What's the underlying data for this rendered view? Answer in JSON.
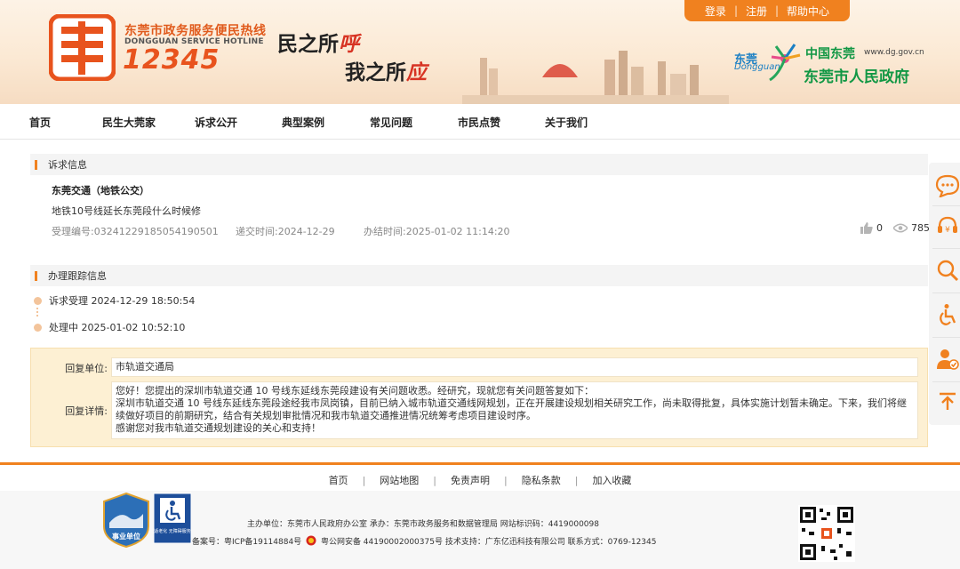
{
  "header": {
    "hotline_cn": "东莞市政务服务便民热线",
    "hotline_en": "DONGGUAN SERVICE HOTLINE",
    "hotline_number": "12345",
    "slogan_line1_a": "民之所",
    "slogan_line1_b": "呼",
    "slogan_line2_a": "我之所",
    "slogan_line2_b": "应",
    "top_links": [
      "登录",
      "注册",
      "帮助中心"
    ],
    "gov_dg": "东莞",
    "gov_dg_en": "Dongguan",
    "gov_cn": "中国东莞",
    "gov_url": "www.dg.gov.cn",
    "gov_name": "东莞市人民政府"
  },
  "nav": [
    "首页",
    "民生大莞家",
    "诉求公开",
    "典型案例",
    "常见问题",
    "市民点赞",
    "关于我们"
  ],
  "appeal": {
    "section_title": "诉求信息",
    "title": "东莞交通（地铁公交）",
    "question": "地铁10号线延长东莞段什么时候修",
    "id_label": "受理编号:",
    "id_value": "03241229185054190501",
    "submit_label": "递交时间:",
    "submit_value": "2024-12-29",
    "done_label": "办结时间:",
    "done_value": "2025-01-02 11:14:20",
    "likes": "0",
    "views": "785"
  },
  "tracking": {
    "section_title": "办理跟踪信息",
    "steps": [
      "诉求受理 2024-12-29 18:50:54",
      "处理中 2025-01-02 10:52:10"
    ]
  },
  "reply": {
    "unit_label": "回复单位:",
    "unit_value": "市轨道交通局",
    "detail_label": "回复详情:",
    "detail_lines": [
      "您好！您提出的深圳市轨道交通 10 号线东延线东莞段建设有关问题收悉。经研究，现就您有关问题答复如下：",
      "深圳市轨道交通 10 号线东延线东莞段途经我市凤岗镇，目前已纳入城市轨道交通线网规划，正在开展建设规划相关研究工作，尚未取得批复，具体实施计划暂未确定。下来，我们将继",
      "续做好项目的前期研究，结合有关规划审批情况和我市轨道交通推进情况统筹考虑项目建设时序。",
      "感谢您对我市轨道交通规划建设的关心和支持！"
    ]
  },
  "footer": {
    "links": [
      "首页",
      "网站地图",
      "免责声明",
      "隐私条款",
      "加入收藏"
    ],
    "badge_text": "事业单位",
    "access_text": "适老化 无障碍服务",
    "line1": "主办单位：东莞市人民政府办公室  承办：东莞市政务服务和数据管理局  网站标识码：4419000098",
    "line2_a": "备案号：粤ICP备19114884号",
    "line2_b": "粤公网安备 44190002000375号  技术支持：广东亿迅科技有限公司  联系方式：0769-12345"
  }
}
